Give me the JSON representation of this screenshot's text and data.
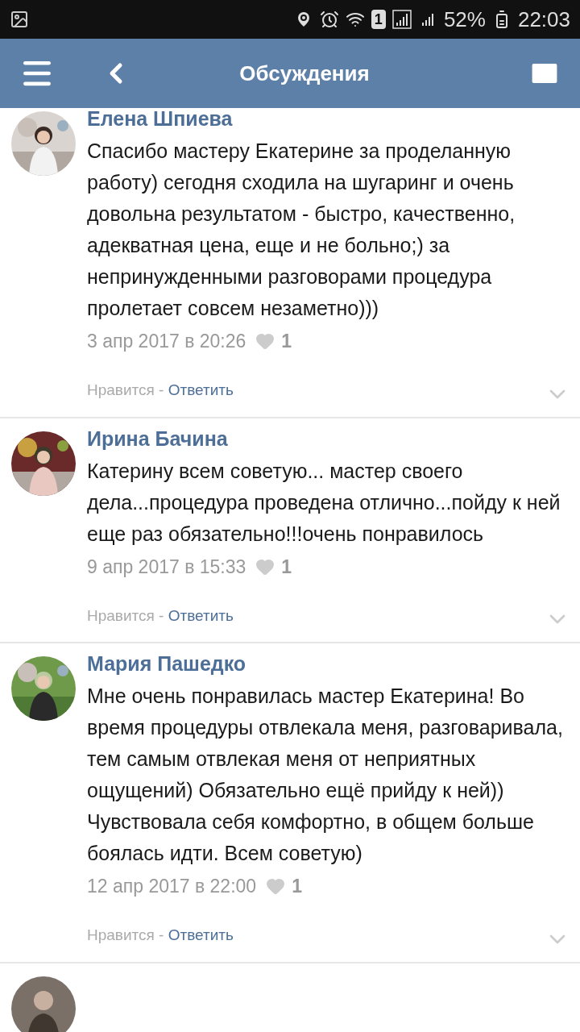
{
  "status_bar": {
    "sim": "1",
    "battery": "52%",
    "time": "22:03"
  },
  "header": {
    "title": "Обсуждения"
  },
  "comments": [
    {
      "author": "Елена Шпиева",
      "text": "Спасибо мастеру Екатерине за проделанную работу) сегодня сходила на шугаринг и очень довольна результатом - быстро, качественно, адекватная цена, еще и не больно;) за непринужденными разговорами процедура пролетает совсем незаметно)))",
      "date": "3 апр 2017 в 20:26",
      "likes": "1",
      "like_label": "Нравится",
      "separator": " - ",
      "reply": "Ответить"
    },
    {
      "author": "Ирина Бачина",
      "text": "Катерину всем советую... мастер своего дела...процедура проведена отлично...пойду к ней еще раз обязательно!!!очень понравилось",
      "date": "9 апр 2017 в 15:33",
      "likes": "1",
      "like_label": "Нравится",
      "separator": " - ",
      "reply": "Ответить"
    },
    {
      "author": "Мария Пашедко",
      "text": "Мне очень понравилась мастер Екатерина! Во время процедуры отвлекала меня, разговаривала, тем самым отвлекая меня от неприятных ощущений) Обязательно ещё прийду к ней)) Чувствовала себя комфортно, в общем больше боялась идти. Всем советую)",
      "date": "12 апр 2017 в 22:00",
      "likes": "1",
      "like_label": "Нравится",
      "separator": " - ",
      "reply": "Ответить"
    }
  ]
}
